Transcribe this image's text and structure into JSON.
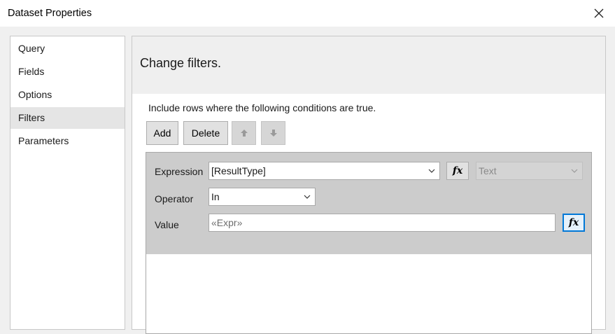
{
  "window": {
    "title": "Dataset Properties"
  },
  "nav": {
    "items": [
      {
        "label": "Query"
      },
      {
        "label": "Fields"
      },
      {
        "label": "Options"
      },
      {
        "label": "Filters",
        "selected": true
      },
      {
        "label": "Parameters"
      }
    ]
  },
  "content": {
    "heading": "Change filters.",
    "description": "Include rows where the following conditions are true."
  },
  "toolbar": {
    "add_label": "Add",
    "delete_label": "Delete",
    "move_up_icon": "arrow-up-icon",
    "move_down_icon": "arrow-down-icon"
  },
  "filter": {
    "expression_label": "Expression",
    "expression_value": "[ResultType]",
    "type_value": "Text",
    "operator_label": "Operator",
    "operator_value": "In",
    "value_label": "Value",
    "value_placeholder": "«Expr»",
    "fx_label": "fx"
  },
  "colors": {
    "focus_accent": "#0078d7",
    "filter_row_bg": "#cccccc"
  }
}
